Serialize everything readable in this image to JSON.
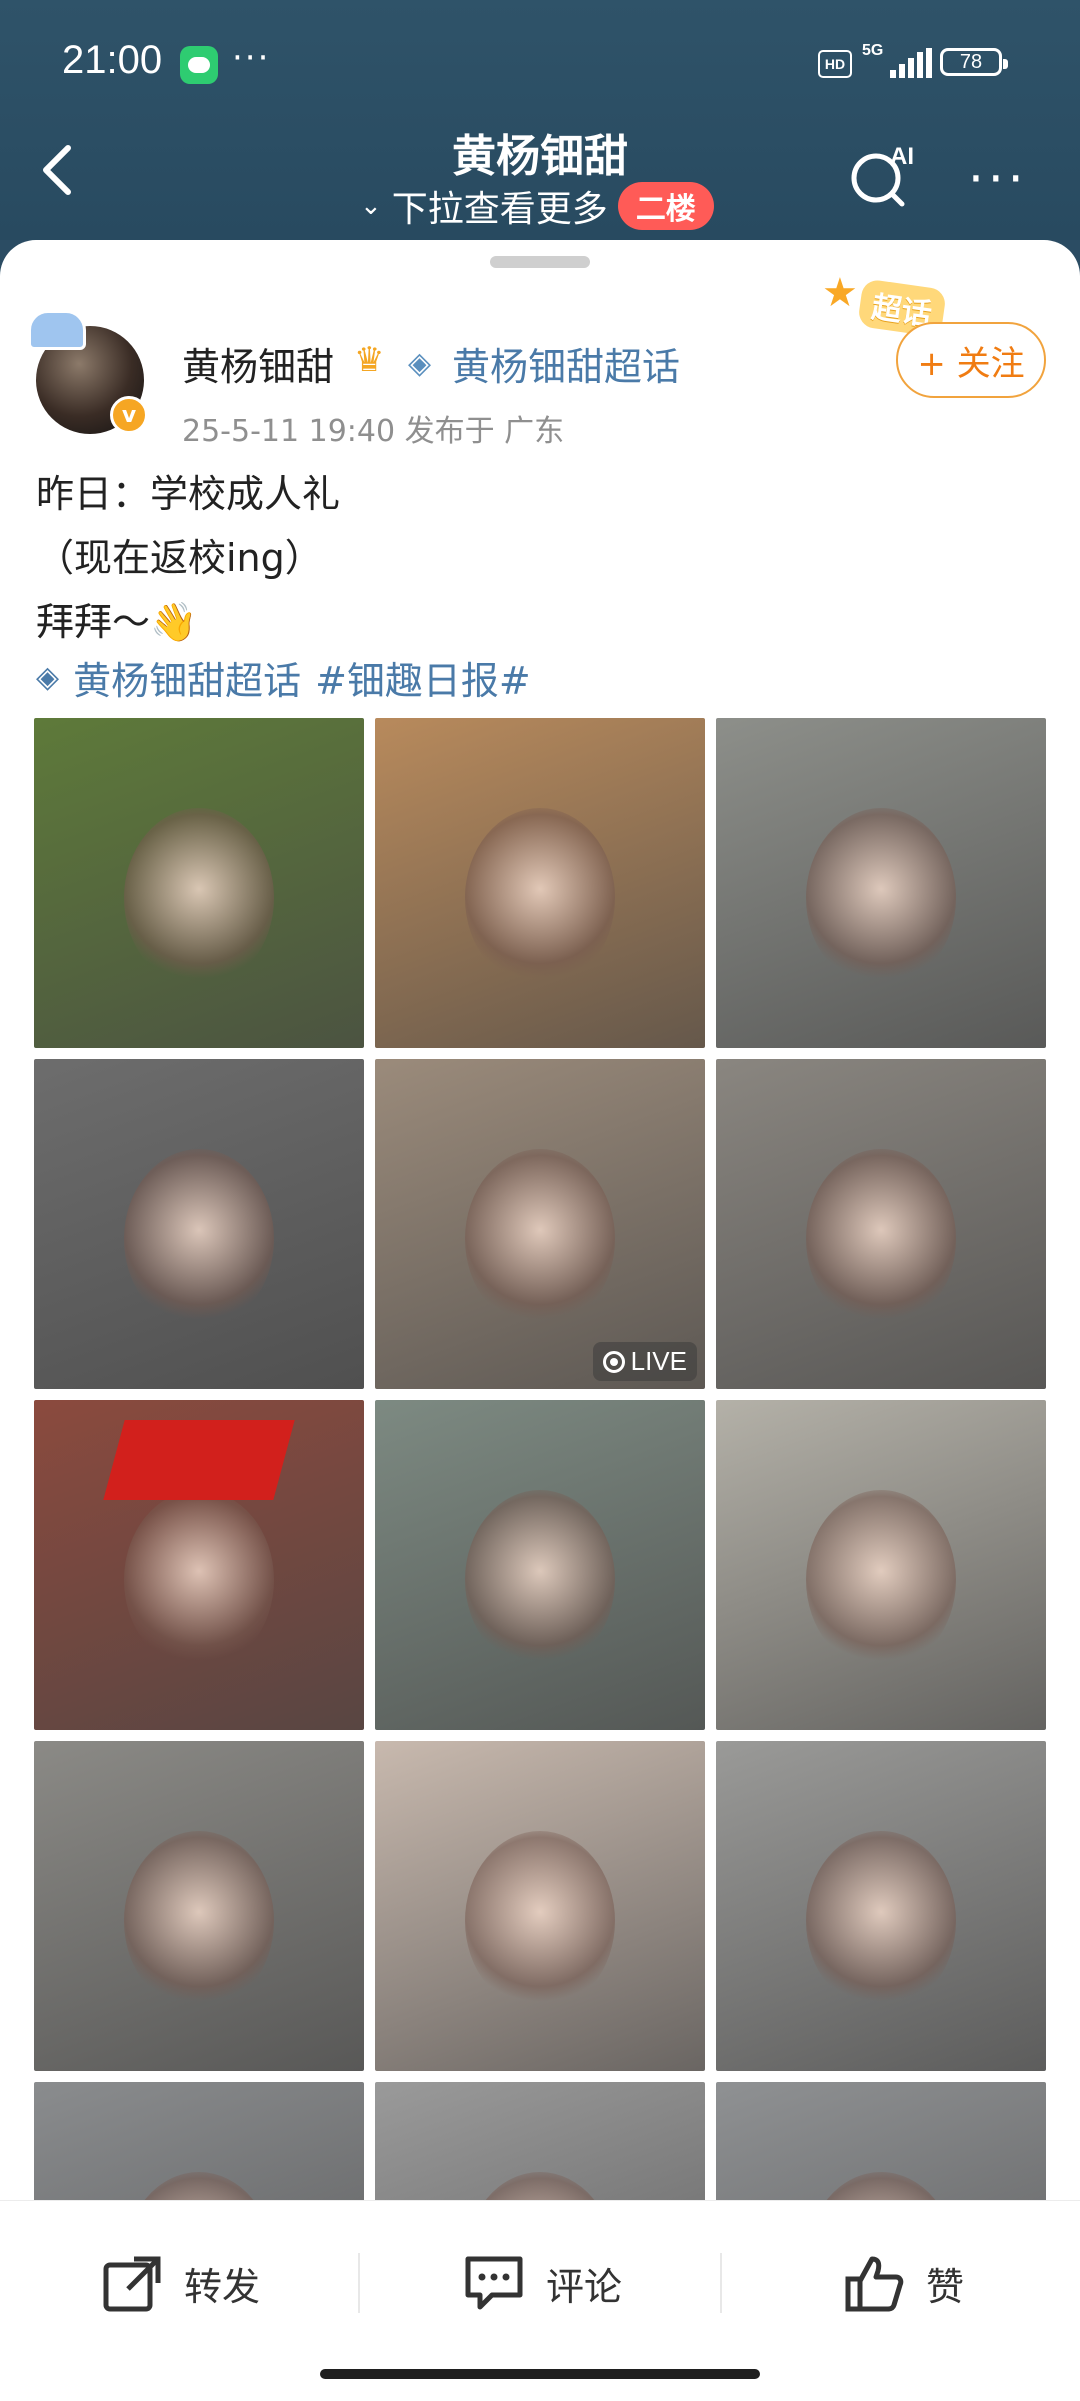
{
  "status_bar": {
    "time": "21:00",
    "hd": "HD",
    "network": "5G",
    "battery": "78"
  },
  "header": {
    "title": "黄杨钿甜",
    "pull_hint": "下拉查看更多",
    "second_floor_badge": "二楼",
    "ai_label": "AI"
  },
  "post": {
    "sticker_label": "超话",
    "author": "黄杨钿甜",
    "supertopic": "黄杨钿甜超话",
    "follow_label": "+ 关注",
    "meta": "25-5-11 19:40   发布于 广东",
    "lines": [
      "昨日：学校成人礼",
      "（现在返校ing）",
      "拜拜～👋"
    ],
    "hashtags": [
      "黄杨钿甜超话",
      "#钿趣日报#"
    ],
    "live_label": "LIVE"
  },
  "photos": [
    {
      "desc": "lying on grass selfie",
      "bg": "#5e7a3a"
    },
    {
      "desc": "mirror selfie with phone",
      "bg": "#b88a5c"
    },
    {
      "desc": "backlit doorway",
      "bg": "#8d8f8a"
    },
    {
      "desc": "close selfie earrings",
      "bg": "#6d6d6d"
    },
    {
      "desc": "selfie live",
      "bg": "#9b8b7b"
    },
    {
      "desc": "backlit doorway 2",
      "bg": "#8a8680"
    },
    {
      "desc": "red graduation cap",
      "bg": "#8b4a3e"
    },
    {
      "desc": "hallway red cap",
      "bg": "#7d8a82"
    },
    {
      "desc": "red carpet selfie",
      "bg": "#b4b1a8"
    },
    {
      "desc": "backlit corridor",
      "bg": "#8b8a86"
    },
    {
      "desc": "close-up face",
      "bg": "#c8b9ae"
    },
    {
      "desc": "selfie fence",
      "bg": "#9a9a98"
    },
    {
      "desc": "grey wall",
      "bg": "#8a8c8e"
    },
    {
      "desc": "grey wall 2",
      "bg": "#9a9a9a"
    },
    {
      "desc": "grey wall 3",
      "bg": "#8f9193"
    }
  ],
  "actions": {
    "repost": "转发",
    "comment": "评论",
    "like": "赞"
  },
  "colors": {
    "header_bg": "#2b4c63",
    "link_blue": "#4a7aa8",
    "follow_orange": "#f07c12",
    "badge_red": "#ff5b57"
  }
}
